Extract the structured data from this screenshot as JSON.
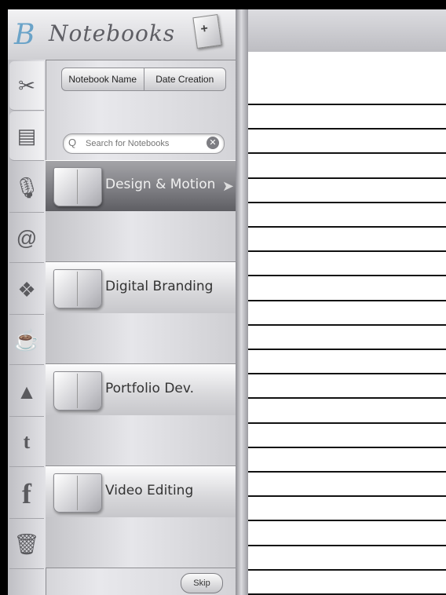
{
  "app": {
    "logo_letter": "B",
    "title": "Notebooks"
  },
  "header": {
    "new_notebook_icon": "new-notebook-icon"
  },
  "sort": {
    "by_name": "Notebook Name",
    "by_date": "Date Creation"
  },
  "search": {
    "placeholder": "Search for Notebooks"
  },
  "side_tools": [
    {
      "name": "tools-icon",
      "glyph": "✂"
    },
    {
      "name": "notebook-icon",
      "glyph": "▤"
    },
    {
      "name": "microphone-icon",
      "glyph": "🎙"
    },
    {
      "name": "email-icon",
      "glyph": "@"
    },
    {
      "name": "dropbox-icon",
      "glyph": "❖"
    },
    {
      "name": "evernote-icon",
      "glyph": "☕"
    },
    {
      "name": "google-drive-icon",
      "glyph": "▲"
    },
    {
      "name": "twitter-icon",
      "glyph": "t"
    },
    {
      "name": "facebook-icon",
      "glyph": "f"
    },
    {
      "name": "trash-icon",
      "glyph": "🗑"
    }
  ],
  "notebooks": [
    {
      "label": "Design & Motion",
      "selected": true
    },
    {
      "label": "Digital Branding",
      "selected": false
    },
    {
      "label": "Portfolio Dev.",
      "selected": false
    },
    {
      "label": "Video Editing",
      "selected": false
    }
  ],
  "footer": {
    "skip_label": "Skip"
  }
}
